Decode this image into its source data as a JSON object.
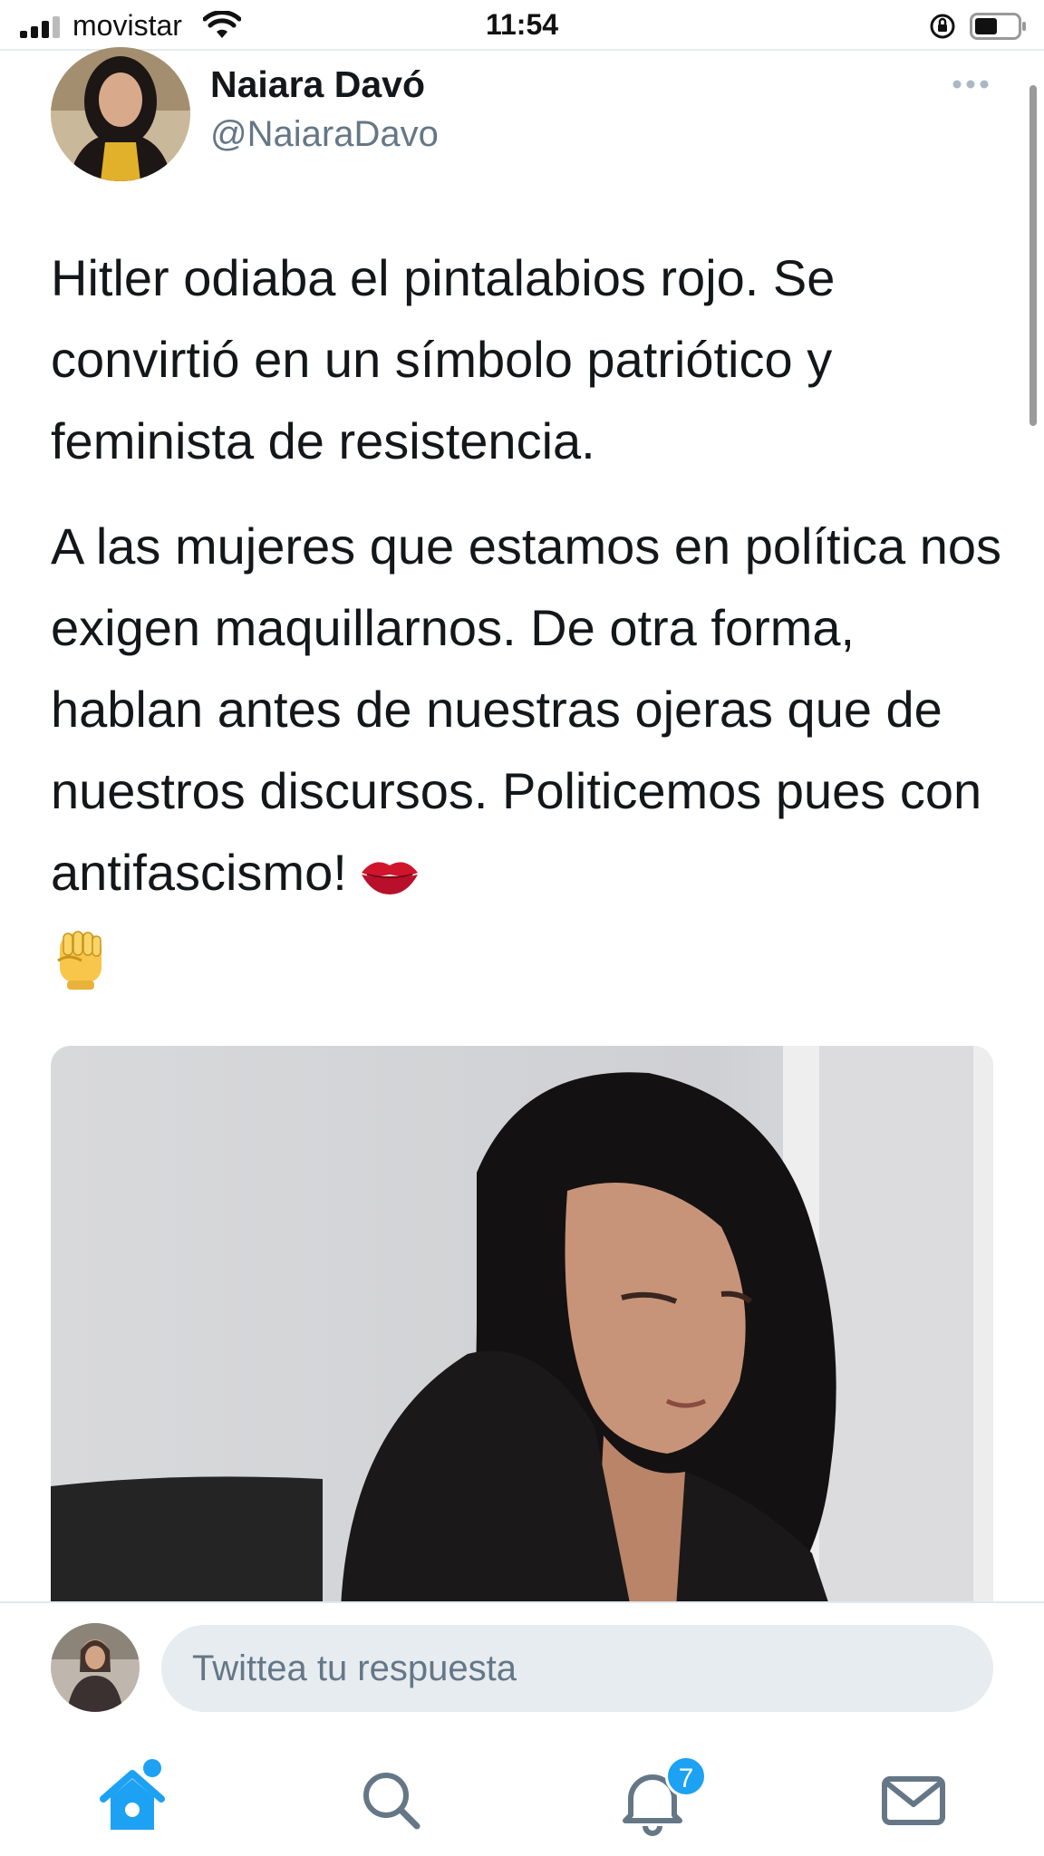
{
  "status_bar": {
    "carrier": "movistar",
    "time": "11:54"
  },
  "tweet": {
    "author_name": "Naiara Davó",
    "author_handle": "@NaiaraDavo",
    "paragraph_1": "Hitler odiaba el pintalabios rojo. Se convirtió en un símbolo patriótico y feminista de resistencia.",
    "paragraph_2": "A las mujeres que estamos en política nos exigen maquillarnos. De otra forma, hablan antes de nuestras ojeras que de nuestros discursos. Politicemos pues con antifascismo!"
  },
  "reply": {
    "placeholder": "Twittea tu respuesta"
  },
  "tab_bar": {
    "notifications_count": "7"
  },
  "colors": {
    "accent": "#1da1f2",
    "text": "#14171a",
    "secondary_text": "#657786",
    "input_bg": "#e6ecf0"
  },
  "icons": [
    "signal-icon",
    "wifi-icon",
    "rotation-lock-icon",
    "battery-icon",
    "more-icon",
    "kiss-mark-emoji",
    "raised-fist-emoji",
    "home-icon",
    "search-icon",
    "bell-icon",
    "mail-icon"
  ]
}
